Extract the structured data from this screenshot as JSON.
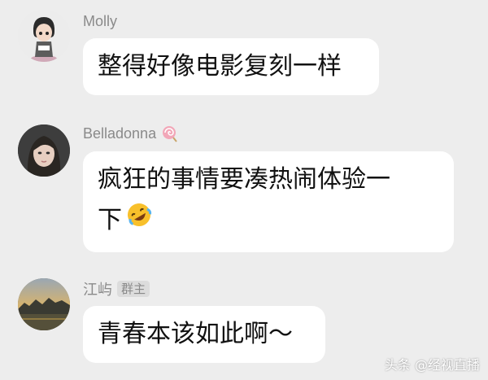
{
  "messages": [
    {
      "sender": "Molly",
      "text": "整得好像电影复刻一样"
    },
    {
      "sender": "Belladonna",
      "sender_emoji": "lollipop-icon",
      "lines": [
        "疯狂的事情要凑热闹体验一",
        "下"
      ],
      "emoji": "rolling-on-floor-laughing-icon"
    },
    {
      "sender": "江屿",
      "badge": "群主",
      "text": "青春本该如此啊～"
    }
  ],
  "watermark": "头条 @经视直播",
  "colors": {
    "background": "#ededed",
    "bubble": "#ffffff",
    "name": "#8a8a8a",
    "badge_bg": "#dcdcdc"
  }
}
